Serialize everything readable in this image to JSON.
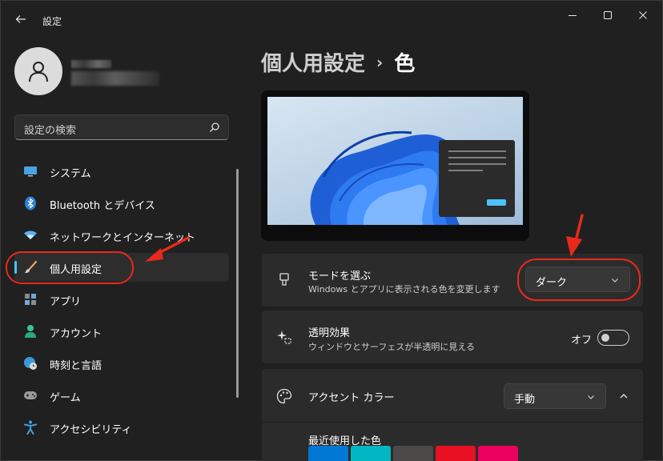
{
  "window": {
    "title": "設定"
  },
  "search": {
    "placeholder": "設定の検索"
  },
  "sidebar": {
    "items": [
      {
        "label": "システム",
        "icon": "monitor-icon"
      },
      {
        "label": "Bluetooth とデバイス",
        "icon": "bluetooth-icon"
      },
      {
        "label": "ネットワークとインターネット",
        "icon": "wifi-icon"
      },
      {
        "label": "個人用設定",
        "icon": "brush-icon",
        "selected": true
      },
      {
        "label": "アプリ",
        "icon": "apps-icon"
      },
      {
        "label": "アカウント",
        "icon": "person-icon"
      },
      {
        "label": "時刻と言語",
        "icon": "globe-clock-icon"
      },
      {
        "label": "ゲーム",
        "icon": "gamepad-icon"
      },
      {
        "label": "アクセシビリティ",
        "icon": "accessibility-icon"
      }
    ]
  },
  "breadcrumb": {
    "parent": "個人用設定",
    "separator": "›",
    "current": "色"
  },
  "mode": {
    "title": "モードを選ぶ",
    "subtitle": "Windows とアプリに表示される色を変更します",
    "value": "ダーク"
  },
  "transparency": {
    "title": "透明効果",
    "subtitle": "ウィンドウとサーフェスが半透明に見える",
    "state_label": "オフ",
    "on": false
  },
  "accent": {
    "title": "アクセント カラー",
    "value": "手動",
    "recent_label": "最近使用した色",
    "recent_colors": [
      "#0078d4",
      "#00b7c3",
      "#4c4a48",
      "#e81123",
      "#ea005e"
    ]
  },
  "colors": {
    "accent": "#4cc2ff",
    "annotation": "#e8291c",
    "background": "#202020",
    "card": "#2b2b2b"
  }
}
